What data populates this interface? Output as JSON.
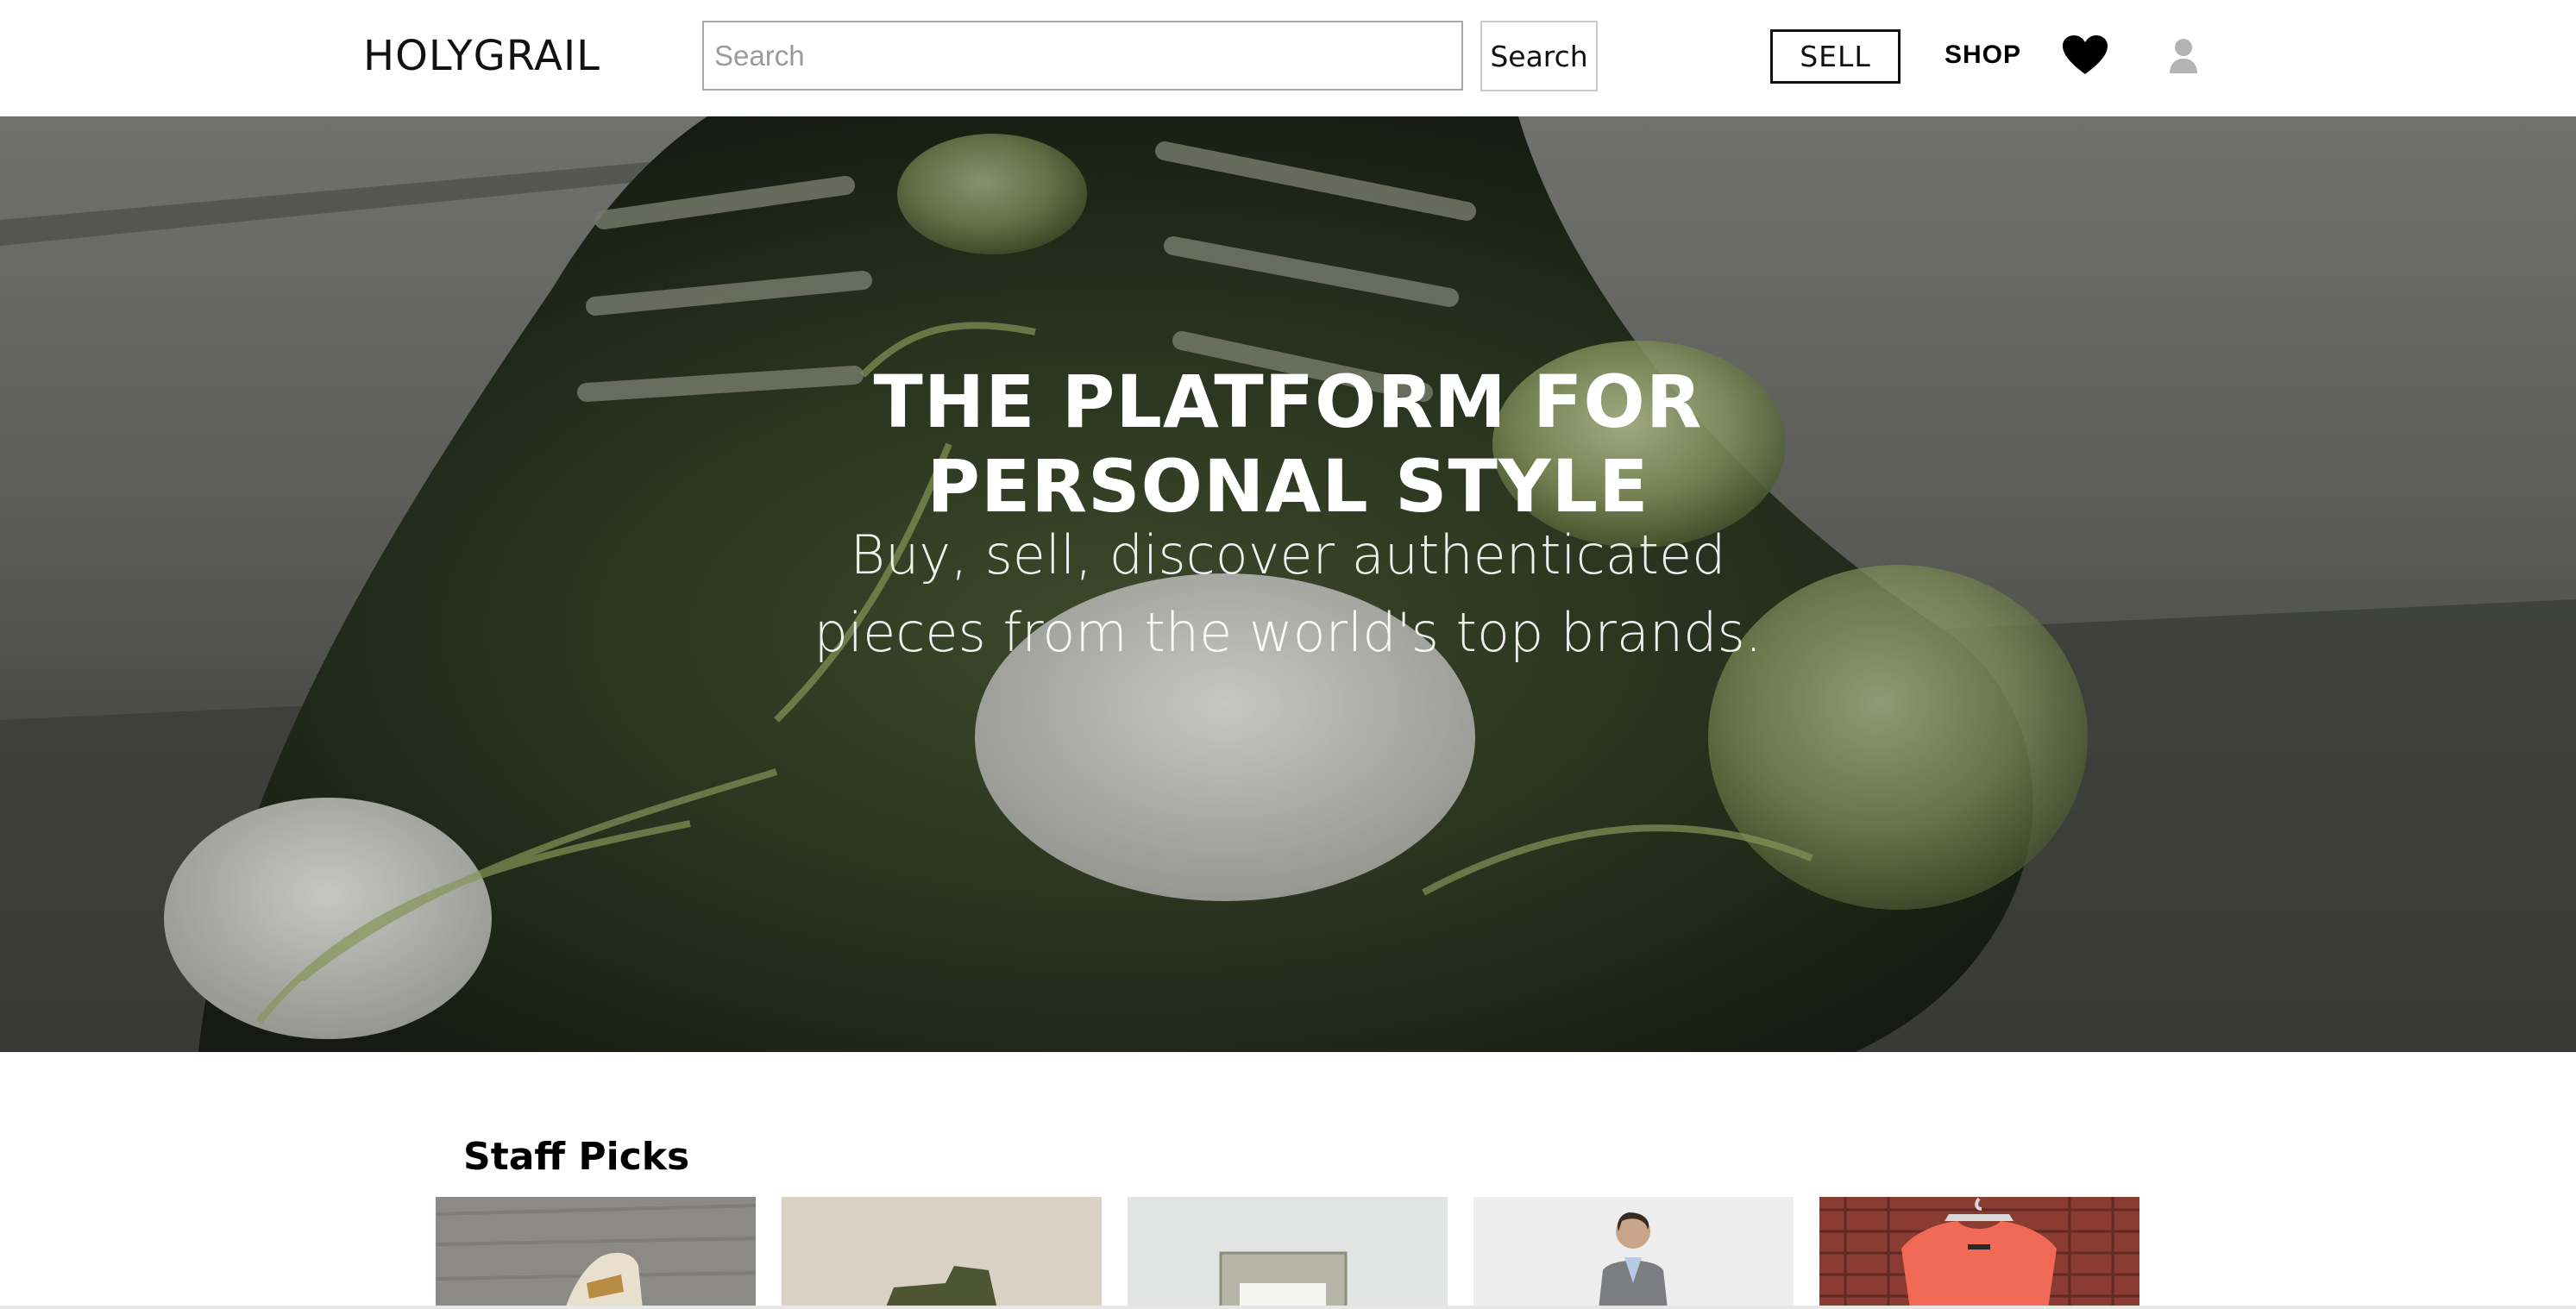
{
  "header": {
    "logo": "HOLYGRAIL",
    "search_placeholder": "Search",
    "search_button": "Search",
    "sell_button": "SELL",
    "shop_link": "SHOP",
    "icons": [
      "heart-icon",
      "user-icon"
    ]
  },
  "hero": {
    "title": "THE PLATFORM FOR PERSONAL STYLE",
    "subtitle": "Buy, sell, discover authenticated pieces from the world's top brands."
  },
  "staff_picks": {
    "title": "Staff Picks"
  },
  "colors": {
    "text": "#000000",
    "background": "#ffffff",
    "hero_overlay_text": "#ffffff",
    "input_border": "#a9a9a9"
  }
}
